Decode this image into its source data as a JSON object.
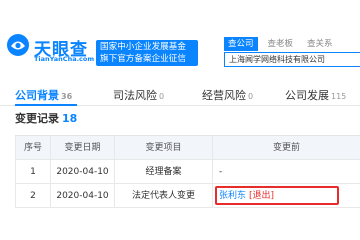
{
  "header": {
    "logo_text": "天眼查",
    "logo_sub": "TianYanCha.com",
    "badge": "国家中小企业发展基金旗下官方备案企业征信机构",
    "search_tabs": [
      "查公司",
      "查老板",
      "查关系"
    ],
    "search_value": "上海闻学网络科技有限公司"
  },
  "nav": [
    {
      "label": "公司背景",
      "count": "36"
    },
    {
      "label": "司法风险",
      "count": "0"
    },
    {
      "label": "经营风险",
      "count": "0"
    },
    {
      "label": "公司发展",
      "count": "115"
    }
  ],
  "section": {
    "title": "变更记录",
    "count": "18"
  },
  "table": {
    "headers": [
      "序号",
      "变更日期",
      "变更项目",
      "变更前"
    ],
    "rows": [
      {
        "no": "1",
        "date": "2020-04-10",
        "item": "经理备案",
        "before": "-",
        "exit": ""
      },
      {
        "no": "2",
        "date": "2020-04-10",
        "item": "法定代表人变更",
        "before": "张利东",
        "exit": "[退出]"
      }
    ]
  },
  "colors": {
    "accent": "#0a84ff",
    "highlight": "#e82c2c"
  },
  "icons": [
    "tianyancha-logo-icon"
  ]
}
